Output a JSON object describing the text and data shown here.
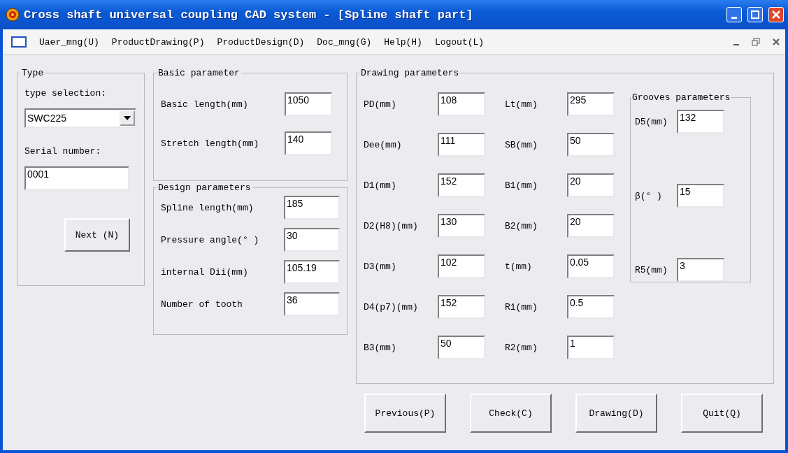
{
  "window": {
    "title": "Cross shaft universal coupling CAD system - [Spline shaft part]"
  },
  "menu": [
    "Uaer_mng(U)",
    "ProductDrawing(P)",
    "ProductDesign(D)",
    "Doc_mng(G)",
    "Help(H)",
    "Logout(L)"
  ],
  "type_group": {
    "title": "Type",
    "type_label": "type selection:",
    "type_value": "SWC225",
    "serial_label": "Serial number:",
    "serial_value": "0001",
    "next_button": "Next (N)"
  },
  "basic_parameter": {
    "title": "Basic parameter",
    "fields": [
      {
        "label": "Basic length(mm)",
        "value": "1050"
      },
      {
        "label": "Stretch length(mm)",
        "value": "140"
      }
    ]
  },
  "design_parameters": {
    "title": "Design parameters",
    "fields": [
      {
        "label": "Spline length(mm)",
        "value": "185"
      },
      {
        "label": "Pressure angle(° )",
        "value": "30"
      },
      {
        "label": "internal Dii(mm)",
        "value": "105.19"
      },
      {
        "label": "Number of tooth",
        "value": "36"
      }
    ]
  },
  "drawing_parameters": {
    "title": "Drawing parameters",
    "rows": [
      [
        {
          "label": "PD(mm)",
          "value": "108"
        },
        {
          "label": "Lt(mm)",
          "value": "295"
        }
      ],
      [
        {
          "label": "Dee(mm)",
          "value": "111"
        },
        {
          "label": "SB(mm)",
          "value": "50"
        }
      ],
      [
        {
          "label": "D1(mm)",
          "value": "152"
        },
        {
          "label": "B1(mm)",
          "value": "20"
        }
      ],
      [
        {
          "label": "D2(H8)(mm)",
          "value": "130"
        },
        {
          "label": "B2(mm)",
          "value": "20"
        }
      ],
      [
        {
          "label": "D3(mm)",
          "value": "102"
        },
        {
          "label": "t(mm)",
          "value": "0.05"
        }
      ],
      [
        {
          "label": "D4(p7)(mm)",
          "value": "152"
        },
        {
          "label": "R1(mm)",
          "value": "0.5"
        }
      ],
      [
        {
          "label": "B3(mm)",
          "value": "50"
        },
        {
          "label": "R2(mm)",
          "value": "1"
        }
      ]
    ],
    "grooves": {
      "title": "Grooves parameters",
      "fields": [
        {
          "label": "D5(mm)",
          "value": "132"
        },
        {
          "label": "β(° )",
          "value": "15"
        },
        {
          "label": "R5(mm)",
          "value": "3"
        }
      ]
    }
  },
  "buttons": [
    "Previous(P)",
    "Check(C)",
    "Drawing(D)",
    "Quit(Q)"
  ]
}
